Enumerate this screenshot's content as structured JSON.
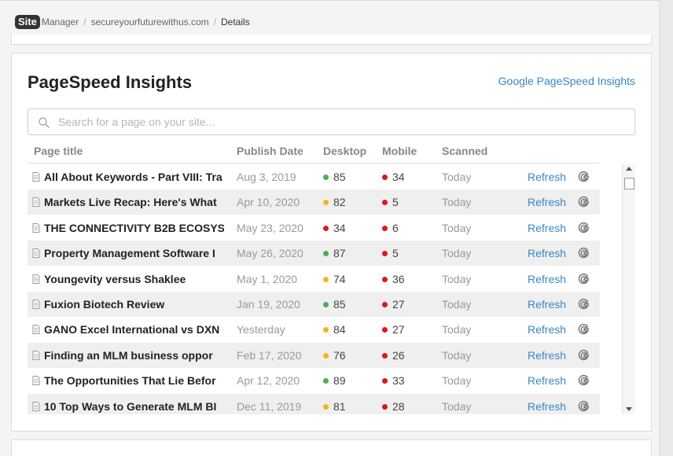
{
  "breadcrumb": {
    "logo": "Site",
    "app": "Manager",
    "site": "secureyourfuturewithus.com",
    "current": "Details"
  },
  "card": {
    "title": "PageSpeed Insights",
    "link": "Google PageSpeed Insights",
    "search_placeholder": "Search for a page on your site..."
  },
  "table": {
    "headers": {
      "title": "Page title",
      "date": "Publish Date",
      "desktop": "Desktop",
      "mobile": "Mobile",
      "scanned": "Scanned"
    },
    "rows": [
      {
        "title": "All About Keywords - Part VIII: Tra",
        "date": "Aug 3, 2019",
        "desktop": "85",
        "desktop_status": "good",
        "mobile": "34",
        "mobile_status": "poor",
        "scanned": "Today",
        "action": "Refresh"
      },
      {
        "title": "Markets Live Recap: Here's What",
        "date": "Apr 10, 2020",
        "desktop": "82",
        "desktop_status": "average",
        "mobile": "5",
        "mobile_status": "poor",
        "scanned": "Today",
        "action": "Refresh"
      },
      {
        "title": "THE CONNECTIVITY B2B ECOSYS",
        "date": "May 23, 2020",
        "desktop": "34",
        "desktop_status": "poor",
        "mobile": "6",
        "mobile_status": "poor",
        "scanned": "Today",
        "action": "Refresh"
      },
      {
        "title": "Property Management Software I",
        "date": "May 26, 2020",
        "desktop": "87",
        "desktop_status": "good",
        "mobile": "5",
        "mobile_status": "poor",
        "scanned": "Today",
        "action": "Refresh"
      },
      {
        "title": "Youngevity versus Shaklee",
        "date": "May 1, 2020",
        "desktop": "74",
        "desktop_status": "average",
        "mobile": "36",
        "mobile_status": "poor",
        "scanned": "Today",
        "action": "Refresh"
      },
      {
        "title": "Fuxion Biotech Review",
        "date": "Jan 19, 2020",
        "desktop": "85",
        "desktop_status": "good",
        "mobile": "27",
        "mobile_status": "poor",
        "scanned": "Today",
        "action": "Refresh"
      },
      {
        "title": "GANO Excel International vs DXN",
        "date": "Yesterday",
        "desktop": "84",
        "desktop_status": "average",
        "mobile": "27",
        "mobile_status": "poor",
        "scanned": "Today",
        "action": "Refresh"
      },
      {
        "title": "Finding an MLM business oppor",
        "date": "Feb 17, 2020",
        "desktop": "76",
        "desktop_status": "average",
        "mobile": "26",
        "mobile_status": "poor",
        "scanned": "Today",
        "action": "Refresh"
      },
      {
        "title": "The Opportunities That Lie Befor",
        "date": "Apr 12, 2020",
        "desktop": "89",
        "desktop_status": "good",
        "mobile": "33",
        "mobile_status": "poor",
        "scanned": "Today",
        "action": "Refresh"
      },
      {
        "title": "10 Top Ways to Generate MLM BI",
        "date": "Dec 11, 2019",
        "desktop": "81",
        "desktop_status": "average",
        "mobile": "28",
        "mobile_status": "poor",
        "scanned": "Today",
        "action": "Refresh"
      }
    ]
  },
  "status_colors": {
    "good": "#4caf50",
    "average": "#f5b41e",
    "poor": "#d9191c"
  },
  "icons": {
    "search": "search-icon",
    "page": "document-icon",
    "google": "google-icon"
  }
}
